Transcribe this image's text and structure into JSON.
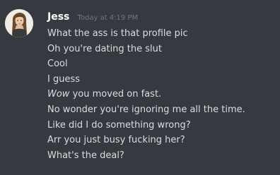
{
  "message": {
    "username": "Jess",
    "username_color": "#ffffff",
    "timestamp": "Today at 4:19 PM",
    "avatar_icon": "user-avatar-photo",
    "lines": [
      {
        "text": "What the ass is that profile pic"
      },
      {
        "text": "Oh you're dating the slut"
      },
      {
        "text": "Cool"
      },
      {
        "text": "I guess"
      },
      {
        "italic": "Wow",
        "text": " you moved on fast."
      },
      {
        "text": "No wonder you're ignoring me all the time."
      },
      {
        "text": "Like did I do something wrong?"
      },
      {
        "text": "Arr you just busy fucking her?"
      },
      {
        "text": "What's the deal?"
      }
    ]
  },
  "colors": {
    "background": "#36393f",
    "message_text": "#dcddde",
    "timestamp": "#72767d"
  }
}
